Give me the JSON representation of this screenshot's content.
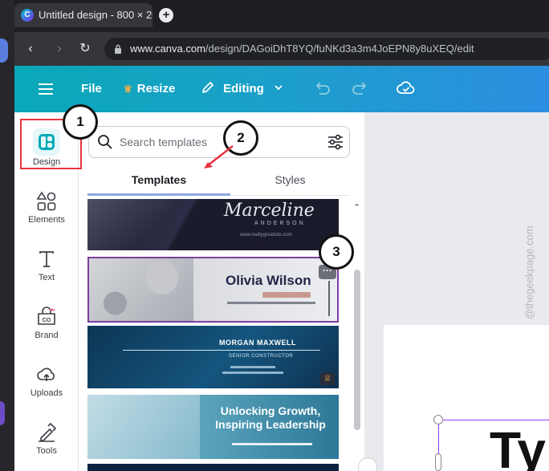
{
  "browser": {
    "tab_title": "Untitled design - 800 × 20",
    "favicon_letter": "C",
    "new_tab": "+",
    "url_host": "www.canva.com",
    "url_path": "/design/DAGoiDhT8YQ/fuNKd3a3m4JoEPN8y8uXEQ/edit"
  },
  "toolbar": {
    "file": "File",
    "resize": "Resize",
    "editing": "Editing"
  },
  "rail": {
    "items": [
      {
        "label": "Design"
      },
      {
        "label": "Elements"
      },
      {
        "label": "Text"
      },
      {
        "label": "Brand"
      },
      {
        "label": "Uploads"
      },
      {
        "label": "Tools"
      }
    ]
  },
  "panel": {
    "search_placeholder": "Search templates",
    "tabs": [
      "Templates",
      "Styles"
    ],
    "templates": [
      {
        "title": "Marceline",
        "subtitle": "ANDERSON",
        "footer": "www.reallygreatsite.com"
      },
      {
        "title": "Olivia Wilson",
        "more": "···"
      },
      {
        "title": "MORGAN MAXWELL",
        "subtitle": "SENIOR CONSTRUCTOR"
      },
      {
        "title": "Unlocking Growth, Inspiring Leadership"
      }
    ]
  },
  "canvas": {
    "watermark": "@thegeekpage.com",
    "text_preview": "Ty"
  },
  "annotations": [
    "1",
    "2",
    "3"
  ],
  "colors": {
    "accent": "#00c4cc",
    "annotation_red": "#e8333f",
    "selected_template": "#7b3fa0"
  }
}
